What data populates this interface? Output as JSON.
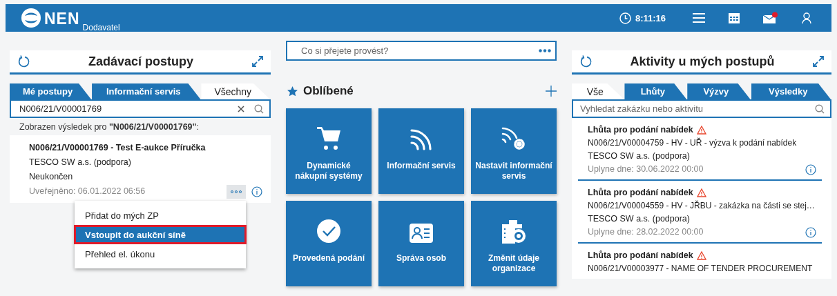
{
  "header": {
    "logo": "NEN",
    "subtitle": "Dodavatel",
    "time": "8:11:16",
    "mail_unread": true
  },
  "procedures": {
    "title": "Zadávací postupy",
    "tabs": [
      {
        "label": "Mé postupy",
        "selected": false
      },
      {
        "label": "Informační servis",
        "selected": false
      },
      {
        "label": "Všechny",
        "selected": true
      }
    ],
    "search": {
      "value": "N006/21/V00001769"
    },
    "result_note": "Zobrazen výsledek pro **\"N006/21/V00001769\"**:",
    "results": [
      {
        "title": "N006/21/V00001769 - Test E-aukce Příručka",
        "company": "TESCO SW a.s. (podpora)",
        "status": "Neukončen",
        "published": "Uveřejněno: 06.01.2022 06:56",
        "menu": [
          {
            "label": "Přidat do mých ZP",
            "selected": false
          },
          {
            "label": "Vstoupit do aukční síně",
            "selected": true
          },
          {
            "label": "Přehled el. úkonu",
            "selected": false
          }
        ]
      }
    ]
  },
  "favorites": {
    "search": {
      "placeholder": "Co si přejete provést?"
    },
    "title": "Oblíbené",
    "tiles": [
      {
        "label": "Dynamické nákupní systémy",
        "kind": "cart"
      },
      {
        "label": "Informační servis",
        "kind": "feed"
      },
      {
        "label": "Nastavit informační servis",
        "kind": "feedgear"
      },
      {
        "label": "Provedená podání",
        "kind": "check"
      },
      {
        "label": "Správa osob",
        "kind": "card"
      },
      {
        "label": "Změnit údaje organizace",
        "kind": "building"
      }
    ]
  },
  "activities": {
    "title": "Aktivity u mých postupů",
    "tabs": [
      {
        "label": "Vše",
        "selected": true
      },
      {
        "label": "Lhůty",
        "selected": false
      },
      {
        "label": "Výzvy",
        "selected": false
      },
      {
        "label": "Výsledky",
        "selected": false
      }
    ],
    "search": {
      "placeholder": "Vyhledat zakázku nebo aktivitu"
    },
    "items": [
      {
        "title": "Lhůta pro podání nabídek",
        "warning": true,
        "name": "N006/21/V00004759 - HV - UŘ - výzva k podání nabídek",
        "company": "TESCO SW a.s. (podpora)",
        "due": "Uplyne dne: 30.06.2022 00:00"
      },
      {
        "title": "Lhůta pro podání nabídek",
        "warning": true,
        "name": "N006/21/V00004559 - HV - JŘBU - zakázka na části se stej…",
        "company": "TESCO SW a.s. (podpora)",
        "due": "Uplyne dne: 28.02.2022 00:00"
      },
      {
        "title": "Lhůta pro podání nabídek",
        "warning": true,
        "name": "N006/21/V00003977 - NAME OF TENDER PROCUREMENT"
      }
    ]
  }
}
